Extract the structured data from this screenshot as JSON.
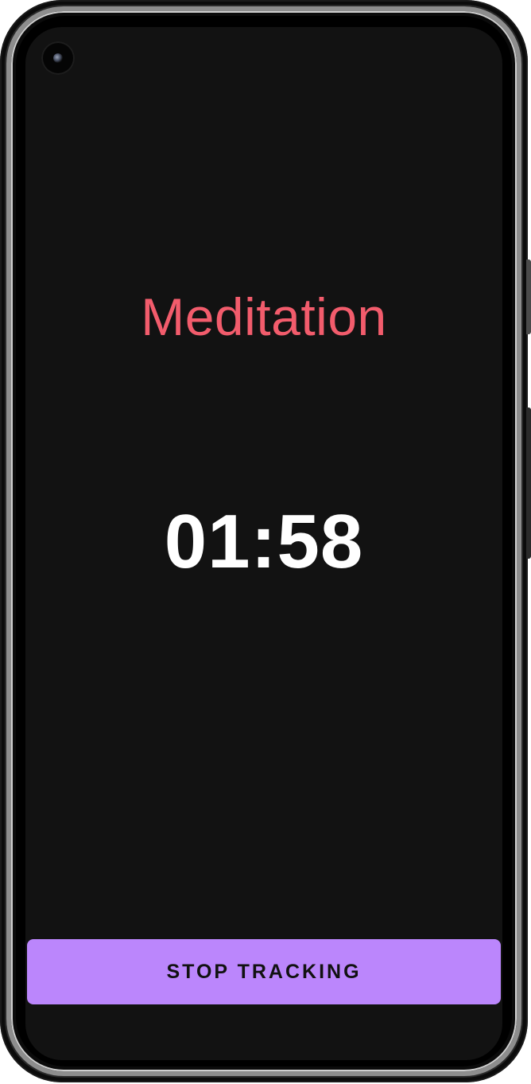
{
  "screen": {
    "activity_title": "Meditation",
    "elapsed_time": "01:58",
    "stop_button_label": "STOP TRACKING"
  },
  "colors": {
    "screen_background": "#121212",
    "title_accent": "#f25c6c",
    "timer_text": "#ffffff",
    "button_background": "#bb86fc",
    "button_text": "#111111"
  },
  "icons": {
    "front_camera": "camera-icon"
  }
}
